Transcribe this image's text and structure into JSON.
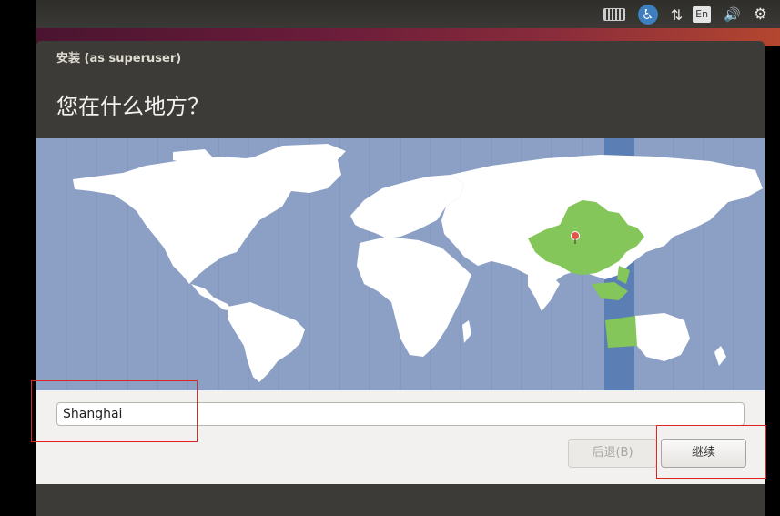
{
  "system_panel": {
    "icons": [
      "keyboard-icon",
      "accessibility-icon",
      "network-icon",
      "language-icon",
      "volume-icon",
      "system-gear-icon"
    ],
    "language_label": "En"
  },
  "window": {
    "title": "安装 (as superuser)",
    "heading": "您在什么地方？"
  },
  "map": {
    "selected_region": "China",
    "timezone_highlight_color": "#5b7fb5",
    "selected_color": "#84c659",
    "land_color": "#ffffff",
    "water_color": "#8ca0c6"
  },
  "location": {
    "value": "Shanghai"
  },
  "buttons": {
    "back_label": "后退(B)",
    "continue_label": "继续"
  },
  "annotations": {
    "color": "#e02424"
  }
}
